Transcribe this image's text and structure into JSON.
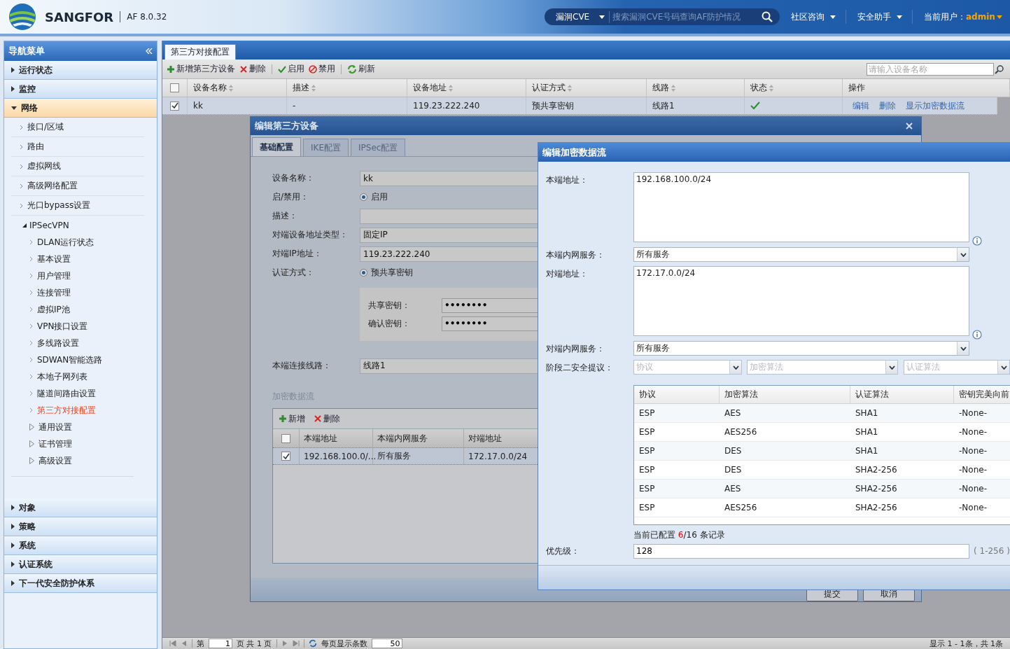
{
  "header": {
    "brand": "SANGFOR",
    "version": "AF 8.0.32",
    "search": {
      "scope": "漏洞CVE",
      "placeholder": "搜索漏洞CVE号码查询AF防护情况"
    },
    "menus": [
      "社区咨询",
      "安全助手"
    ],
    "user_label": "当前用户：",
    "user": "admin"
  },
  "sidebar": {
    "title": "导航菜单",
    "sections": [
      {
        "label": "运行状态",
        "expanded": false
      },
      {
        "label": "监控",
        "expanded": false
      },
      {
        "label": "网络",
        "expanded": true,
        "children": [
          {
            "kind": "page",
            "label": "接口/区域"
          },
          {
            "kind": "page",
            "label": "路由"
          },
          {
            "kind": "page",
            "label": "虚拟网线"
          },
          {
            "kind": "page",
            "label": "高级网络配置"
          },
          {
            "kind": "page",
            "label": "光口bypass设置"
          },
          {
            "kind": "group",
            "label": "IPSecVPN",
            "expanded": true,
            "children": [
              {
                "kind": "page",
                "label": "DLAN运行状态",
                "selected": false
              },
              {
                "kind": "page",
                "label": "基本设置",
                "selected": false
              },
              {
                "kind": "page",
                "label": "用户管理",
                "selected": false
              },
              {
                "kind": "page",
                "label": "连接管理",
                "selected": false
              },
              {
                "kind": "page",
                "label": "虚拟IP池",
                "selected": false
              },
              {
                "kind": "page",
                "label": "VPN接口设置",
                "selected": false
              },
              {
                "kind": "page",
                "label": "多线路设置",
                "selected": false
              },
              {
                "kind": "page",
                "label": "SDWAN智能选路",
                "selected": false
              },
              {
                "kind": "page",
                "label": "本地子网列表",
                "selected": false
              },
              {
                "kind": "page",
                "label": "隧道间路由设置",
                "selected": false
              },
              {
                "kind": "page",
                "label": "第三方对接配置",
                "selected": true
              },
              {
                "kind": "folder",
                "label": "通用设置",
                "selected": false
              },
              {
                "kind": "folder",
                "label": "证书管理",
                "selected": false
              },
              {
                "kind": "folder",
                "label": "高级设置",
                "selected": false
              }
            ]
          }
        ]
      },
      {
        "label": "对象",
        "expanded": false
      },
      {
        "label": "策略",
        "expanded": false
      },
      {
        "label": "系统",
        "expanded": false
      },
      {
        "label": "认证系统",
        "expanded": false
      },
      {
        "label": "下一代安全防护体系",
        "expanded": false
      }
    ]
  },
  "main": {
    "tabs": [
      {
        "label": "第三方对接配置",
        "selected": true
      }
    ],
    "toolbar": [
      {
        "kind": "add",
        "label": "新增第三方设备"
      },
      {
        "kind": "delete",
        "label": "删除"
      },
      {
        "kind": "enable",
        "label": "启用"
      },
      {
        "kind": "disable",
        "label": "禁用"
      },
      {
        "kind": "refresh",
        "label": "刷新"
      }
    ],
    "search_placeholder": "请输入设备名称",
    "table": {
      "header_checked": false,
      "columns": [
        "设备名称",
        "描述",
        "设备地址",
        "认证方式",
        "线路",
        "状态",
        "操作"
      ],
      "rows": [
        {
          "checked": true,
          "cells": [
            "kk",
            "-",
            "119.23.222.240",
            "预共享密钥",
            "线路1"
          ],
          "enabled": true,
          "actions": [
            "编辑",
            "删除",
            "显示加密数据流"
          ]
        }
      ]
    },
    "pager": {
      "page_prefix": "第",
      "page": "1",
      "page_suffix": "页 共 1 页",
      "page_size_label": "每页显示条数",
      "page_size": "50",
      "summary": "显示 1 - 1条，共 1条"
    }
  },
  "device_dialog": {
    "title": "编辑第三方设备",
    "tabs": [
      {
        "label": "基础配置",
        "selected": true
      },
      {
        "label": "IKE配置",
        "selected": false
      },
      {
        "label": "IPSec配置",
        "selected": false
      }
    ],
    "fields": [
      {
        "kind": "input",
        "label": "设备名称：",
        "value": "kk"
      },
      {
        "kind": "radio",
        "label": "启/禁用：",
        "option": "启用",
        "checked": true
      },
      {
        "kind": "input",
        "label": "描述："
      },
      {
        "kind": "input",
        "label": "对端设备地址类型：",
        "value": "固定IP"
      },
      {
        "kind": "input",
        "label": "对端IP地址：",
        "value": "119.23.222.240"
      },
      {
        "kind": "radio",
        "label": "认证方式：",
        "option": "预共享密钥",
        "checked": true
      },
      {
        "kind": "keys",
        "fields": [
          {
            "label": "共享密钥：",
            "value": "••••••••"
          },
          {
            "label": "确认密钥：",
            "value": "••••••••"
          }
        ]
      },
      {
        "kind": "input",
        "label": "本端连接线路：",
        "value": "线路1"
      }
    ],
    "flow": {
      "title": "加密数据流",
      "toolbar": [
        {
          "kind": "add",
          "label": "新增"
        },
        {
          "kind": "delete",
          "label": "删除"
        }
      ],
      "header_checked": false,
      "columns": [
        "本端地址",
        "本端内网服务",
        "对端地址"
      ],
      "rows": [
        {
          "checked": true,
          "cells": [
            "192.168.100.0/...",
            "所有服务",
            "172.17.0.0/24"
          ]
        }
      ]
    },
    "buttons": [
      "提交",
      "取消"
    ]
  },
  "flow_dialog": {
    "title": "编辑加密数据流",
    "fields": [
      {
        "kind": "textarea",
        "label": "本端地址：",
        "value": "192.168.100.0/24"
      },
      {
        "kind": "select",
        "label": "本端内网服务：",
        "value": "所有服务"
      },
      {
        "kind": "textarea",
        "label": "对端地址：",
        "value": "172.17.0.0/24"
      },
      {
        "kind": "select",
        "label": "对端内网服务：",
        "value": "所有服务"
      },
      {
        "kind": "proposal",
        "label": "阶段二安全提议：",
        "placeholders": [
          "协议",
          "加密算法",
          "认证算法"
        ]
      }
    ],
    "proposals": {
      "columns": [
        "协议",
        "加密算法",
        "认证算法",
        "密钥完美向前"
      ],
      "rows": [
        [
          "ESP",
          "AES",
          "SHA1",
          "-None-"
        ],
        [
          "ESP",
          "AES256",
          "SHA1",
          "-None-"
        ],
        [
          "ESP",
          "DES",
          "SHA1",
          "-None-"
        ],
        [
          "ESP",
          "DES",
          "SHA2-256",
          "-None-"
        ],
        [
          "ESP",
          "AES",
          "SHA2-256",
          "-None-"
        ],
        [
          "ESP",
          "AES256",
          "SHA2-256",
          "-None-"
        ]
      ]
    },
    "count": {
      "prefix": "当前已配置",
      "configured": "6",
      "suffix": "/16 条记录"
    },
    "priority": {
      "label": "优先级：",
      "value": "128",
      "hint": "( 1-256 )"
    }
  }
}
